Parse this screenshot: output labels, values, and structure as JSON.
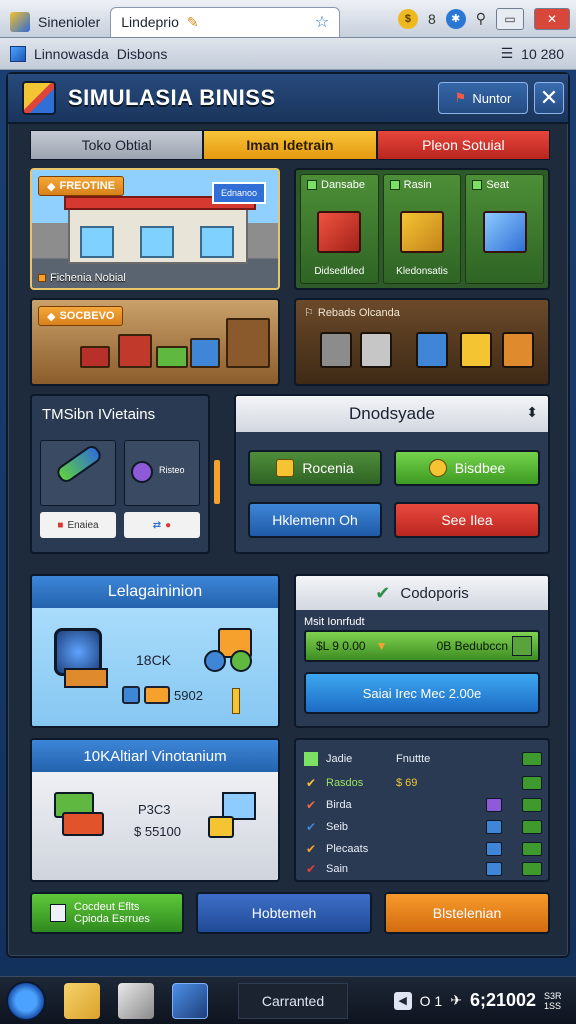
{
  "os_bar": {
    "tab1_label": "Sinenioler",
    "tab2_label": "Lindeprio",
    "right_icon1": "$",
    "right_icon2": "8"
  },
  "second_bar": {
    "tab1_label": "Linnowasda",
    "tab2_label": "Disbons",
    "right_text": "10  280"
  },
  "app": {
    "title": "SIMULASIA BINISS",
    "header_button": "Nuntor",
    "tabs": [
      "Toko Obtial",
      "Iman Idetrain",
      "Pleon Sotuial"
    ]
  },
  "panels": {
    "store_chip": "FREOTINE",
    "store_sign": "Ednanoo",
    "store_caption": "Fichenia Nobial",
    "products": [
      {
        "title": "Dansabe",
        "caption": "Didsedlded"
      },
      {
        "title": "Rasin",
        "caption": "Kledonsatis"
      },
      {
        "title": "Seat",
        "caption": ""
      }
    ],
    "warehouse_chip": "SOCBEVO",
    "purchase_label": "Rebads Olcanda"
  },
  "stats": {
    "title": "TMSibn IVietains",
    "slot2_lines": "Risteo",
    "foot1": "Enaiea",
    "foot2": ""
  },
  "select": {
    "title": "Dnodsyade",
    "buttons": [
      "Rocenia",
      "Bisdbee",
      "Hklemenn Oh",
      "See Ilea"
    ]
  },
  "evaluation": {
    "title": "Lelagaininion",
    "text": "18CK",
    "value": "5902"
  },
  "codeport": {
    "title": "Codoporis",
    "sublabel": "Msit Ionrfudt",
    "bar_left": "$L 9 0.00",
    "bar_right": "0B Bedubccn",
    "button": "Saiai Irec Mec 2.00e"
  },
  "info": {
    "title": "10KAltiarl Vinotanium",
    "line1": "P3C3",
    "line2": "$ 55100"
  },
  "list": {
    "rows": [
      {
        "name": "Jadie",
        "mid": "Fnuttte"
      },
      {
        "name": "Rasdos",
        "mid": "$ 69"
      },
      {
        "name": "Birda",
        "mid": ""
      },
      {
        "name": "Seib",
        "mid": ""
      },
      {
        "name": "Plecaats",
        "mid": ""
      },
      {
        "name": "Sain",
        "mid": ""
      }
    ]
  },
  "bottom": {
    "green": "Cocdeut Eflts Cpioda Esrrues",
    "blue": "Hobtemeh",
    "orange": "Blstelenian"
  },
  "taskbar": {
    "label": "Carranted",
    "tray_text": "O 1",
    "clock": "6;21002",
    "clock_small": "S3R 1SS"
  }
}
